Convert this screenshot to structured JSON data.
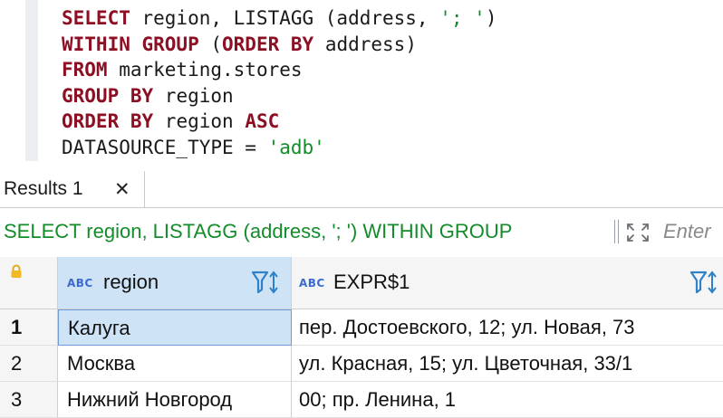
{
  "editor": {
    "lines": [
      [
        {
          "t": "SELECT",
          "c": "kw"
        },
        {
          "t": " region, LISTAGG (address, ",
          "c": "plain"
        },
        {
          "t": "'; '",
          "c": "str"
        },
        {
          "t": ")",
          "c": "plain"
        }
      ],
      [
        {
          "t": "WITHIN GROUP",
          "c": "kw"
        },
        {
          "t": " (",
          "c": "plain"
        },
        {
          "t": "ORDER BY",
          "c": "kw"
        },
        {
          "t": " address)",
          "c": "plain"
        }
      ],
      [
        {
          "t": "FROM",
          "c": "kw"
        },
        {
          "t": " marketing.stores",
          "c": "plain"
        }
      ],
      [
        {
          "t": "GROUP BY",
          "c": "kw"
        },
        {
          "t": " region",
          "c": "plain"
        }
      ],
      [
        {
          "t": "ORDER BY",
          "c": "kw"
        },
        {
          "t": " region ",
          "c": "plain"
        },
        {
          "t": "ASC",
          "c": "kw"
        }
      ],
      [
        {
          "t": "DATASOURCE_TYPE = ",
          "c": "plain"
        },
        {
          "t": "'adb'",
          "c": "str"
        }
      ]
    ]
  },
  "results_tab": {
    "label": "Results 1",
    "close": "✕"
  },
  "query_bar": {
    "query_text": "SELECT region, LISTAGG (address, '; ') WITHIN GROUP",
    "filter_placeholder": "Enter"
  },
  "grid": {
    "type_badge": "ABC",
    "columns": [
      "region",
      "EXPR$1"
    ],
    "rows": [
      {
        "num": "1",
        "region": "Калуга",
        "expr": "пер. Достоевского, 12; ул. Новая, 73"
      },
      {
        "num": "2",
        "region": "Москва",
        "expr": "ул. Красная, 15; ул. Цветочная, 33/1"
      },
      {
        "num": "3",
        "region": "Нижний Новгород",
        "expr": "00; пр. Ленина, 1"
      }
    ]
  },
  "colors": {
    "keyword": "#8c0f23",
    "string": "#138c2a",
    "selection": "#cfe3f7",
    "badge": "#3a6ad0"
  }
}
